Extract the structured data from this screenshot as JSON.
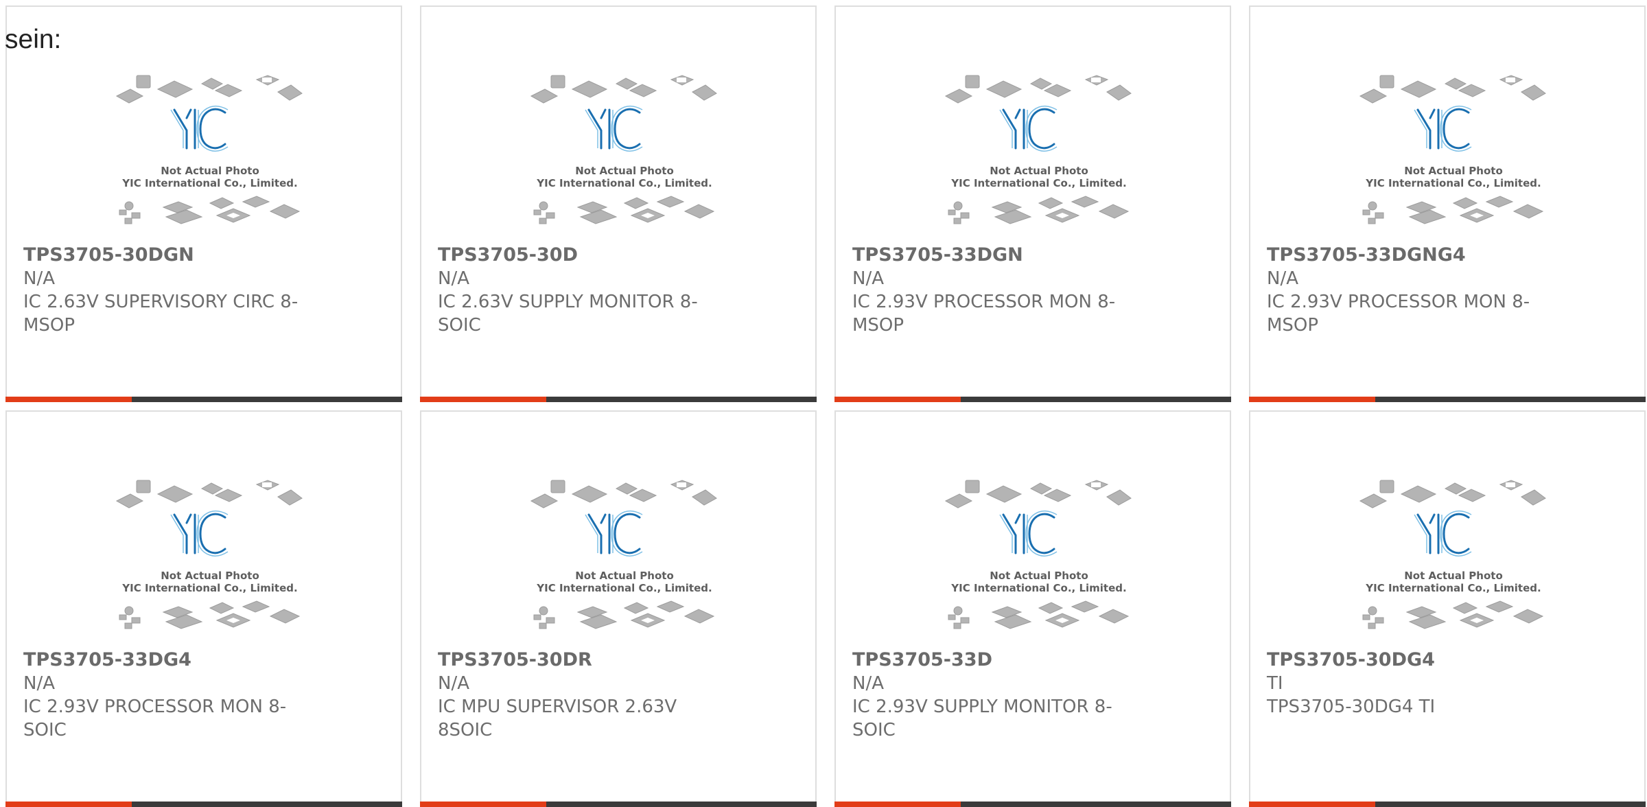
{
  "prefix_text": "sein:",
  "colors": {
    "bar_dark": "#3b3b3b",
    "bar_accent": "#e23d18",
    "logo_blue": "#1a6fb0",
    "card_border": "#dedede"
  },
  "placeholder": {
    "logo_text": "YIC",
    "caption_line1": "Not Actual Photo",
    "caption_line2": "YIC International Co., Limited."
  },
  "products": [
    {
      "part": "TPS3705-30DGN",
      "manufacturer": "N/A",
      "description": "IC 2.63V SUPERVISORY CIRC 8-\nMSOP"
    },
    {
      "part": "TPS3705-30D",
      "manufacturer": "N/A",
      "description": "IC 2.63V SUPPLY MONITOR 8-\nSOIC"
    },
    {
      "part": "TPS3705-33DGN",
      "manufacturer": "N/A",
      "description": "IC 2.93V PROCESSOR MON 8-\nMSOP"
    },
    {
      "part": "TPS3705-33DGNG4",
      "manufacturer": "N/A",
      "description": "IC 2.93V PROCESSOR MON 8-\nMSOP"
    },
    {
      "part": "TPS3705-33DG4",
      "manufacturer": "N/A",
      "description": "IC 2.93V PROCESSOR MON 8-\nSOIC"
    },
    {
      "part": "TPS3705-30DR",
      "manufacturer": "N/A",
      "description": "IC MPU SUPERVISOR 2.63V\n8SOIC"
    },
    {
      "part": "TPS3705-33D",
      "manufacturer": "N/A",
      "description": "IC 2.93V SUPPLY MONITOR 8-\nSOIC"
    },
    {
      "part": "TPS3705-30DG4",
      "manufacturer": "TI",
      "description": "TPS3705-30DG4 TI"
    }
  ]
}
